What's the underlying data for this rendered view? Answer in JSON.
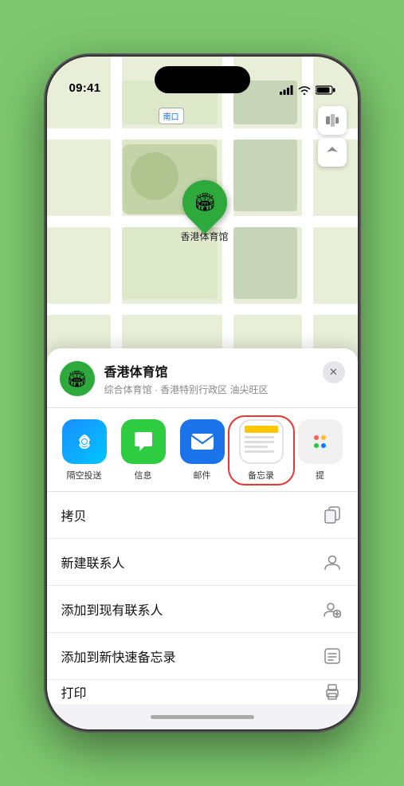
{
  "status_bar": {
    "time": "09:41",
    "location_arrow": true
  },
  "map": {
    "label_south_entrance": "南口",
    "location_name": "香港体育馆",
    "pin_label": "香港体育馆"
  },
  "venue_sheet": {
    "name": "香港体育馆",
    "subtitle": "综合体育馆 · 香港特别行政区 油尖旺区",
    "close_label": "✕"
  },
  "apps": [
    {
      "id": "airdrop",
      "label": "隔空投送"
    },
    {
      "id": "messages",
      "label": "信息"
    },
    {
      "id": "mail",
      "label": "邮件"
    },
    {
      "id": "notes",
      "label": "备忘录",
      "selected": true
    },
    {
      "id": "more",
      "label": "提"
    }
  ],
  "actions": [
    {
      "id": "copy",
      "label": "拷贝",
      "icon": "copy"
    },
    {
      "id": "new-contact",
      "label": "新建联系人",
      "icon": "person"
    },
    {
      "id": "add-existing",
      "label": "添加到现有联系人",
      "icon": "person-add"
    },
    {
      "id": "quick-note",
      "label": "添加到新快速备忘录",
      "icon": "note"
    }
  ],
  "partial_action": {
    "label": "打印",
    "icon": "print"
  }
}
